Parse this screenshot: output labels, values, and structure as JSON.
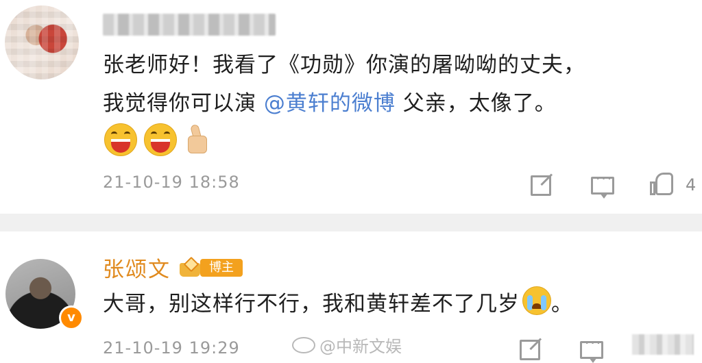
{
  "comments": [
    {
      "username": "",
      "text_line1": "张老师好！我看了《功勋》你演的屠呦呦的丈夫，",
      "text_line2_prefix": "我觉得你可以演",
      "mention": "@黄轩的微博",
      "text_line2_suffix": " 父亲，太像了。",
      "emojis": [
        "laugh-emoji",
        "laugh-emoji",
        "thumbs-up-emoji"
      ],
      "timestamp": "21-10-19 18:58",
      "likes": "4"
    },
    {
      "username": "张颂文",
      "badge": "博主",
      "text_before_emoji": "大哥，别这样行不行，我和黄轩差不了几岁",
      "emoji": "crying-emoji",
      "text_after_emoji": "。",
      "timestamp": "21-10-19 19:29",
      "verified_mark": "v"
    }
  ],
  "watermark": "@中新文娱",
  "colors": {
    "mention": "#4c7fd0",
    "username_highlight": "#e08a1e",
    "badge": "#f3a11e",
    "meta_text": "#9a9a9a",
    "separator": "#f0f0f0"
  }
}
